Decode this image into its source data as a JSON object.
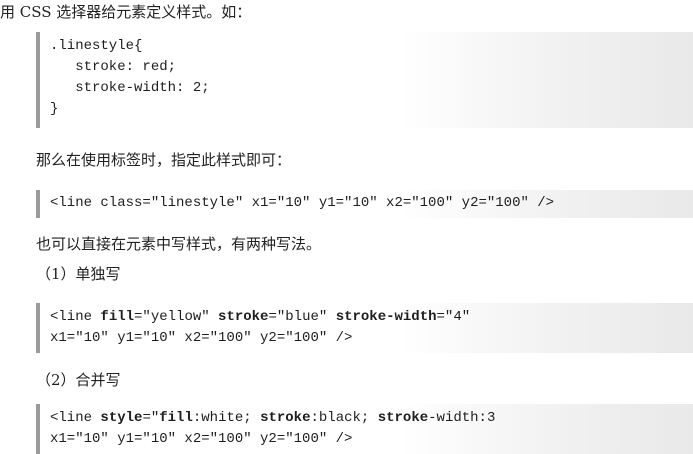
{
  "intro": "用 CSS 选择器给元素定义样式。如：",
  "css_block": {
    "line1": ".linestyle{",
    "line2": "   stroke: red;",
    "line3": "   stroke-width: 2;",
    "line4": "}"
  },
  "usage_text": "那么在使用标签时，指定此样式即可：",
  "usage_code": "<line class=\"linestyle\" x1=\"10\" y1=\"10\" x2=\"100\" y2=\"100\" />",
  "inline_intro": "也可以直接在元素中写样式，有两种写法。",
  "method1_label": "（1）单独写",
  "method1": {
    "l1_a": "<line ",
    "l1_b": "fill",
    "l1_c": "=\"yellow\" ",
    "l1_d": "stroke",
    "l1_e": "=\"blue\" ",
    "l1_f": "stroke-width",
    "l1_g": "=\"4\"",
    "l2": "x1=\"10\" y1=\"10\" x2=\"100\" y2=\"100\" />"
  },
  "method2_label": "（2）合并写",
  "method2": {
    "l1_a": "<line ",
    "l1_b": "style",
    "l1_c": "=\"",
    "l1_d": "fill",
    "l1_e": ":white; ",
    "l1_f": "stroke",
    "l1_g": ":black; ",
    "l1_h": "stroke",
    "l1_i": "-width:3",
    "l2": "x1=\"10\" y1=\"10\" x2=\"100\" y2=\"100\" />"
  }
}
